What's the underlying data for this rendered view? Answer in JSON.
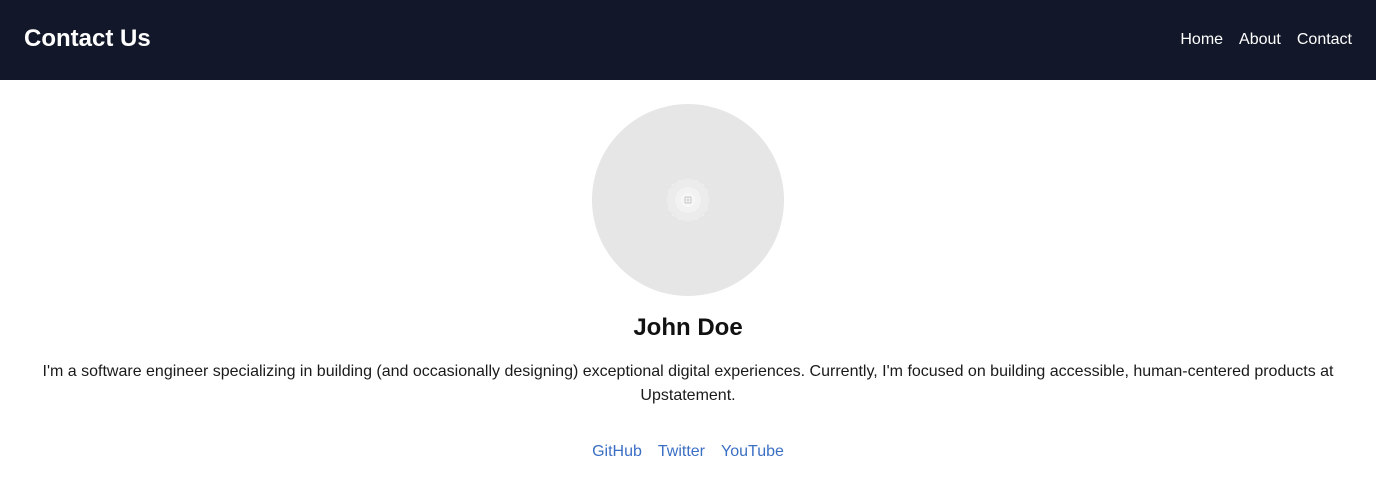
{
  "header": {
    "title": "Contact Us",
    "nav": [
      "Home",
      "About",
      "Contact"
    ]
  },
  "profile": {
    "avatar_icon": "image-placeholder-icon",
    "name": "John Doe",
    "bio": "I'm a software engineer specializing in building (and occasionally designing) exceptional digital experiences. Currently, I'm focused on building accessible, human-centered products at Upstatement.",
    "links": [
      "GitHub",
      "Twitter",
      "YouTube"
    ]
  },
  "colors": {
    "header_bg": "#121829",
    "link": "#3b6fc4",
    "avatar_bg": "#e6e6e6"
  }
}
